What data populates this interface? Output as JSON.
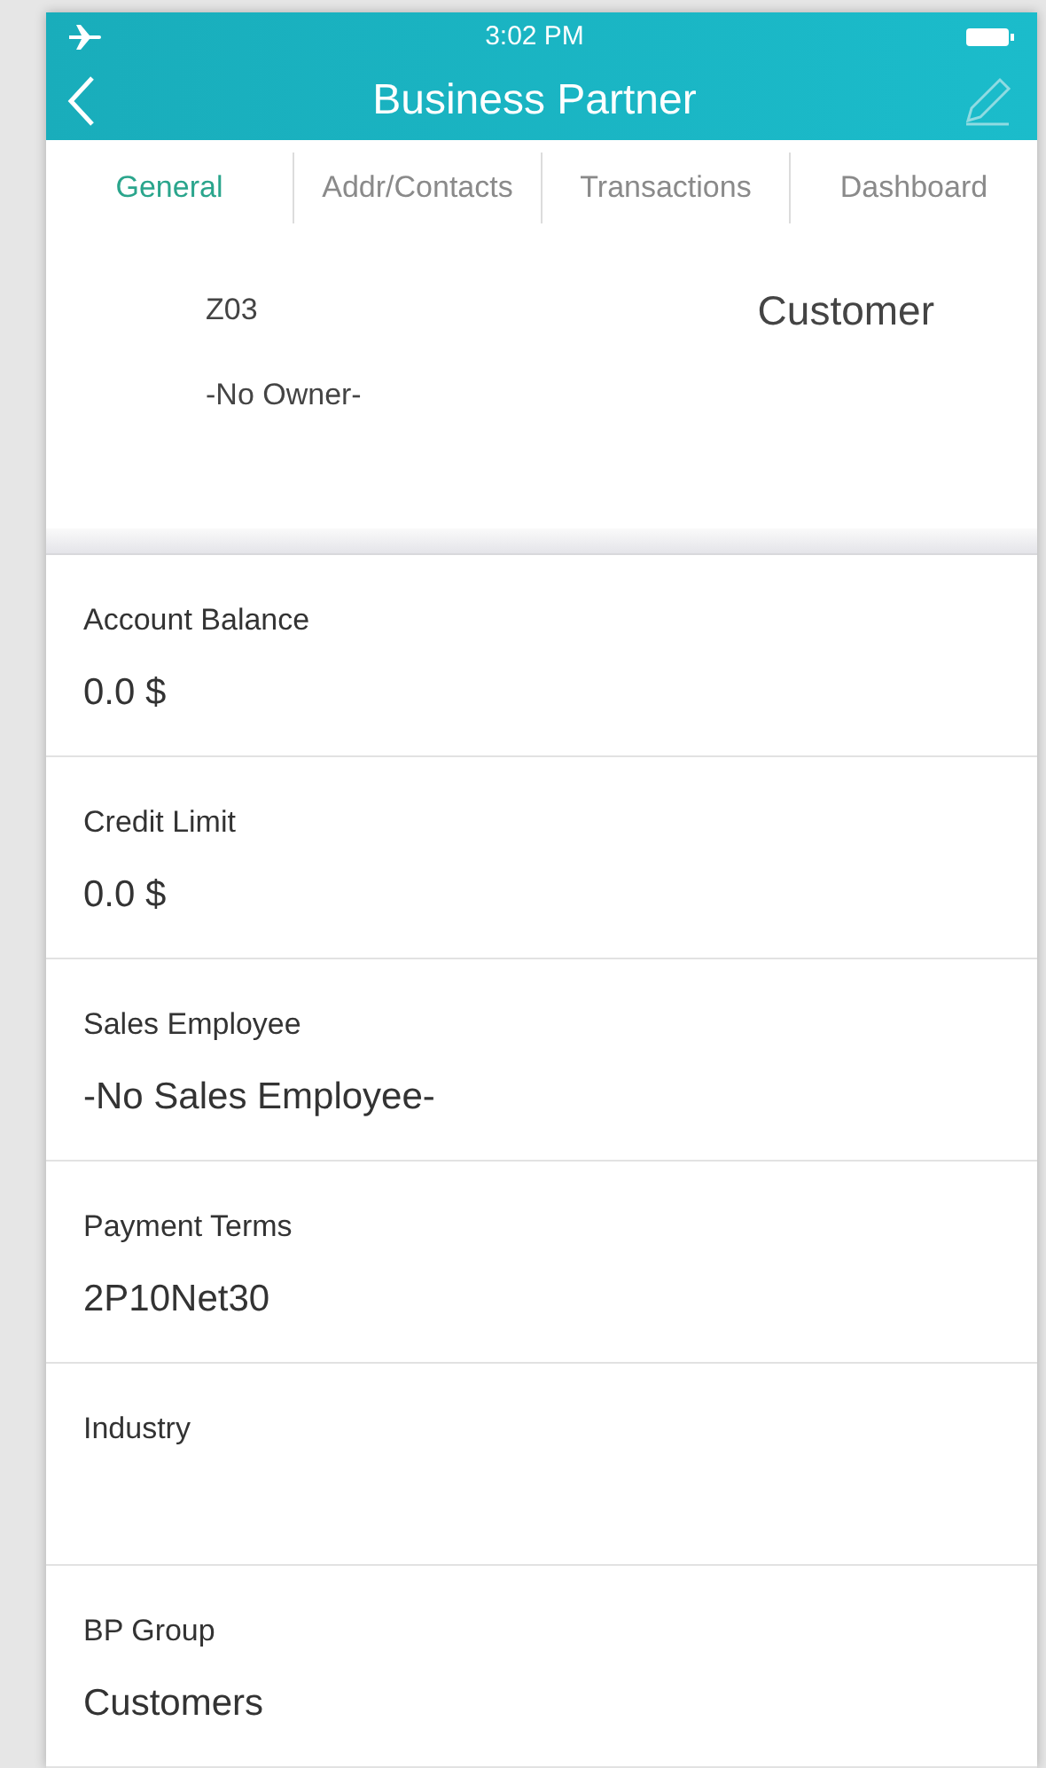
{
  "status_bar": {
    "time": "3:02 PM"
  },
  "nav": {
    "title": "Business Partner"
  },
  "tabs": [
    {
      "label": "General",
      "selected": true
    },
    {
      "label": "Addr/Contacts",
      "selected": false
    },
    {
      "label": "Transactions",
      "selected": false
    },
    {
      "label": "Dashboard",
      "selected": false
    }
  ],
  "header": {
    "code": "Z03",
    "owner": "-No Owner-",
    "type": "Customer"
  },
  "fields": [
    {
      "label": "Account Balance",
      "value": "0.0 $"
    },
    {
      "label": "Credit Limit",
      "value": "0.0 $"
    },
    {
      "label": "Sales Employee",
      "value": "-No Sales Employee-"
    },
    {
      "label": "Payment Terms",
      "value": "2P10Net30"
    },
    {
      "label": "Industry"
    },
    {
      "label": "BP Group",
      "value": "Customers"
    }
  ]
}
